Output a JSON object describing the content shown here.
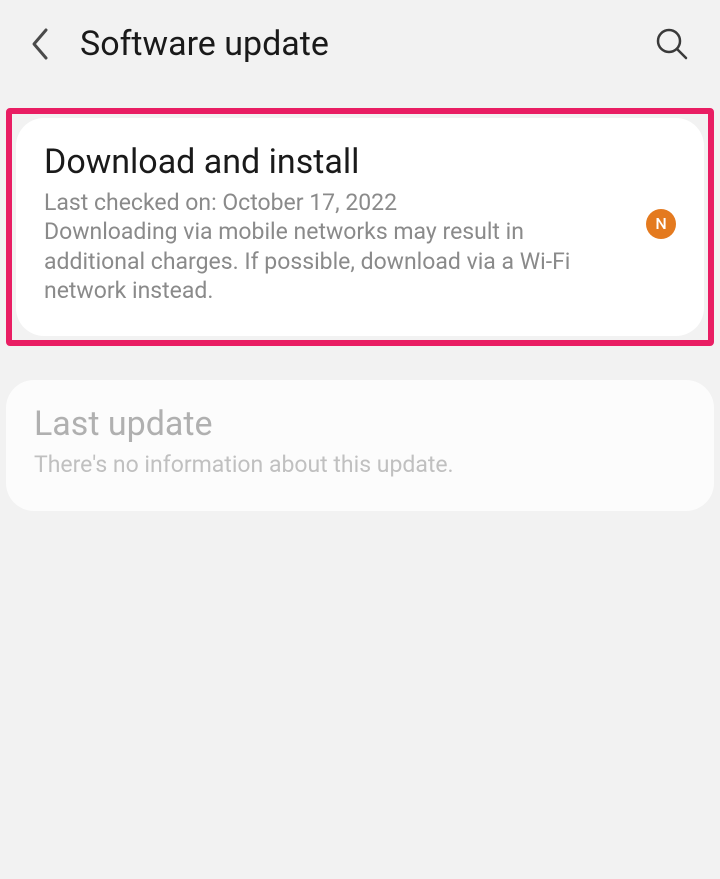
{
  "header": {
    "title": "Software update"
  },
  "cards": {
    "download": {
      "title": "Download and install",
      "line1": "Last checked on: October 17, 2022",
      "line2": "Downloading via mobile networks may result in additional charges. If possible, download via a Wi-Fi network instead.",
      "badge": "N"
    },
    "lastUpdate": {
      "title": "Last update",
      "subtitle": "There's no information about this update."
    }
  },
  "colors": {
    "highlight": "#e91e63",
    "badge": "#e47a1f"
  }
}
